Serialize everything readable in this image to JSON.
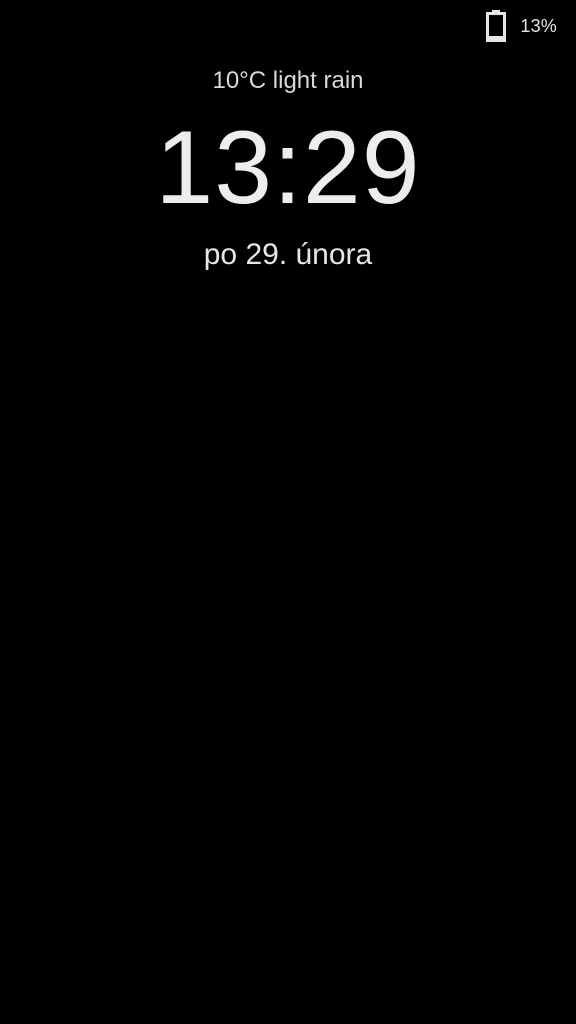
{
  "status_bar": {
    "battery_icon": "battery-icon",
    "battery_level": 0.13,
    "battery_text": "13%"
  },
  "lock_clock": {
    "weather": "10°C light rain",
    "time": "13:29",
    "date": "po 29. února"
  },
  "colors": {
    "background": "#000000",
    "text": "#e6e6e6"
  }
}
